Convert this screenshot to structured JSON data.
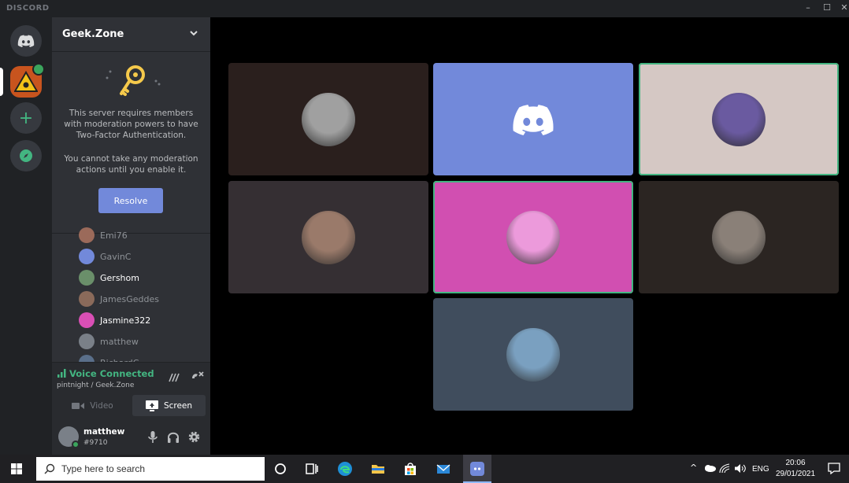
{
  "app": {
    "title": "DISCORD"
  },
  "server": {
    "name": "Geek.Zone",
    "twofa_text_1": "This server requires members with moderation powers to have Two-Factor Authentication.",
    "twofa_text_2": "You cannot take any moderation actions until you enable it.",
    "resolve_label": "Resolve"
  },
  "members": [
    {
      "name": "Emi76",
      "color": "#8e9297",
      "avatar": "#9b6a5a"
    },
    {
      "name": "GavinC",
      "color": "#8e9297",
      "avatar": "#7289da"
    },
    {
      "name": "Gershom",
      "color": "#ffffff",
      "avatar": "#6a8f6a"
    },
    {
      "name": "JamesGeddes",
      "color": "#8e9297",
      "avatar": "#8a6a5a"
    },
    {
      "name": "Jasmine322",
      "color": "#ffffff",
      "avatar": "#d94fb5"
    },
    {
      "name": "matthew",
      "color": "#8e9297",
      "avatar": "#7a8088"
    },
    {
      "name": "RichardC",
      "color": "#8e9297",
      "avatar": "#5a6f8a"
    }
  ],
  "voice": {
    "status": "Voice Connected",
    "channel": "pintnight / Geek.Zone",
    "video_label": "Video",
    "screen_label": "Screen"
  },
  "user": {
    "name": "matthew",
    "tag": "#9710"
  },
  "tiles": [
    {
      "bg": "#2a1f1d",
      "face": "#a0a0a0",
      "speaking": false
    },
    {
      "bg": "#7289da",
      "face": "discord",
      "speaking": false
    },
    {
      "bg": "#d5c8c4",
      "face": "#6a5aa0",
      "speaking": true
    },
    {
      "bg": "#352f33",
      "face": "#9a7a6a",
      "speaking": false
    },
    {
      "bg": "#d14fb1",
      "face": "#ec9adb",
      "speaking": true
    },
    {
      "bg": "#2b2522",
      "face": "#8a8078",
      "speaking": false
    },
    {
      "bg": "#404d5d",
      "face": "#7aa0c0",
      "speaking": false
    }
  ],
  "taskbar": {
    "search_placeholder": "Type here to search",
    "language": "ENG",
    "time": "20:06",
    "date": "29/01/2021"
  }
}
